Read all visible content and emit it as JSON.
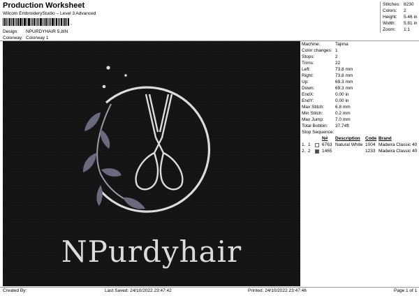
{
  "header": {
    "title": "Production Worksheet",
    "software": "Wilcom EmbroideryStudio – Level 3 Advanced",
    "barcode_separator": ",",
    "design_label": "Design:",
    "design_value": "NPURDYHAIR 5,8IN",
    "colorway_label": "Colorway:",
    "colorway_value": "Colorway 1"
  },
  "stats": [
    {
      "label": "Stitches:",
      "value": "8230"
    },
    {
      "label": "Colors:",
      "value": "2"
    },
    {
      "label": "Height:",
      "value": "5.46 in"
    },
    {
      "label": "Width:",
      "value": "5.81 in"
    },
    {
      "label": "Zoom:",
      "value": "1:1"
    }
  ],
  "info": [
    {
      "label": "Machine:",
      "value": "Tajima"
    },
    {
      "label": "Color changes:",
      "value": "1"
    },
    {
      "label": "Stops:",
      "value": "2"
    },
    {
      "label": "Trims:",
      "value": "22"
    },
    {
      "label": "Left:",
      "value": "73.8 mm"
    },
    {
      "label": "Right:",
      "value": "73.8 mm"
    },
    {
      "label": "Up:",
      "value": "69.3 mm"
    },
    {
      "label": "Down:",
      "value": "69.3 mm"
    },
    {
      "label": "EndX:",
      "value": "0.00 in"
    },
    {
      "label": "EndY:",
      "value": "0.00 in"
    },
    {
      "label": "Max Stitch:",
      "value": "6.8 mm"
    },
    {
      "label": "Min Stitch:",
      "value": "0.2 mm"
    },
    {
      "label": "Max Jump:",
      "value": "7.0 mm"
    },
    {
      "label": "Total Bobbin:",
      "value": "37.74ft"
    }
  ],
  "sequence": {
    "title": "Stop Sequence:",
    "headers": {
      "code": "Code",
      "brand": "Brand",
      "n": "N#",
      "description": "Description"
    },
    "rows": [
      {
        "stop": "1.",
        "num": "1",
        "swatch": "#ffffff",
        "n": "6763",
        "description": "Natural White",
        "code": "1004",
        "brand": "Madeira Classic 40"
      },
      {
        "stop": "2.",
        "num": "2",
        "swatch": "#4a4a5a",
        "n": "1465",
        "description": "",
        "code": "1233",
        "brand": "Madeira Classic 40"
      }
    ]
  },
  "design": {
    "text": "NPurdyhair",
    "thread_white": "#dcdcdc",
    "thread_purple": "#6a6a7e",
    "background": "#141414"
  },
  "footer": {
    "created": "Created By:",
    "saved": "Last Saved: 24/10/2022 23:47:42",
    "printed": "Printed: 24/10/2022 23:47:46",
    "page": "Page 1 of 1"
  }
}
